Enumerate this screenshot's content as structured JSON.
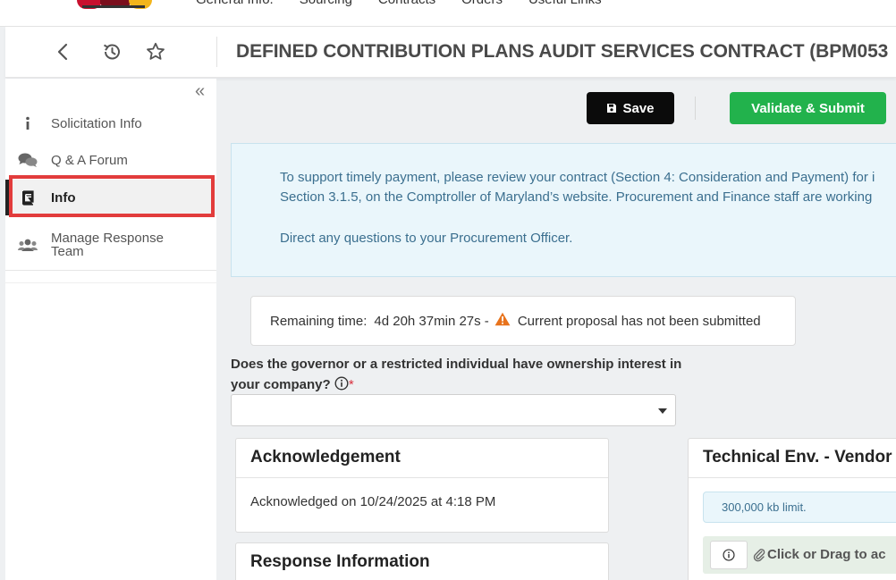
{
  "topnav": {
    "links": [
      "General Info.",
      "Sourcing",
      "Contracts",
      "Orders",
      "Useful Links"
    ]
  },
  "header": {
    "title": "DEFINED CONTRIBUTION PLANS AUDIT SERVICES CONTRACT (BPM053"
  },
  "sidebar": {
    "items": [
      {
        "label": "Solicitation Info",
        "icon": "info-icon"
      },
      {
        "label": "Q & A Forum",
        "icon": "chat-bubbles-icon"
      },
      {
        "label": "Info",
        "icon": "book-icon",
        "active": true
      },
      {
        "label": "Manage Response Team",
        "icon": "users-icon"
      }
    ]
  },
  "actions": {
    "save_label": "Save",
    "submit_label": "Validate & Submit"
  },
  "notice": {
    "line1": "To support timely payment, please review your contract (Section 4: Consideration and Payment) for i",
    "line2": "Section 3.1.5, on the Comptroller of Maryland’s website. Procurement and Finance staff are working",
    "line3": "Direct any questions to your Procurement Officer."
  },
  "timer": {
    "label": "Remaining time:",
    "value": "4d 20h 37min 27s -",
    "status": "Current proposal has not been submitted"
  },
  "question": {
    "text": "Does the governor or a restricted individual have ownership interest in your company?",
    "required_mark": "*",
    "selected_value": ""
  },
  "acknowledgement": {
    "title": "Acknowledgement",
    "text": "Acknowledged on 10/24/2025 at 4:18 PM"
  },
  "response_info": {
    "title": "Response Information"
  },
  "technical": {
    "title": "Technical Env. - Vendor T",
    "limit_text": "300,000 kb limit.",
    "drop_text": "Click or Drag to ac"
  },
  "colors": {
    "save_bg": "#0b0b0b",
    "submit_bg": "#22b24c",
    "highlight": "#e23c3c",
    "notice_bg": "#eaf6fb",
    "notice_text": "#3b6f8f",
    "warning": "#e8731c"
  }
}
